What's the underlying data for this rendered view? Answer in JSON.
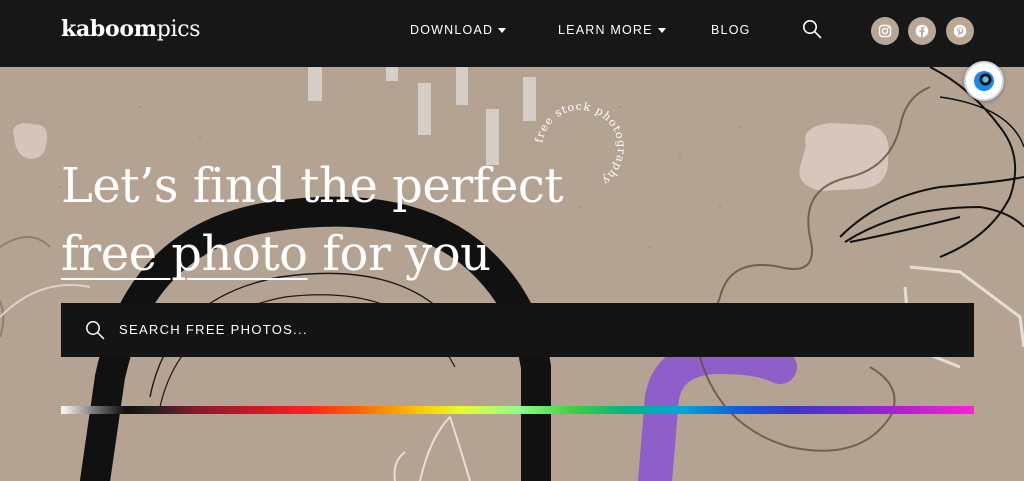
{
  "header": {
    "logo_bold": "kaboom",
    "logo_light": "pics",
    "nav": [
      {
        "label": "DOWNLOAD",
        "dropdown": true
      },
      {
        "label": "LEARN MORE",
        "dropdown": true
      },
      {
        "label": "BLOG",
        "dropdown": false
      }
    ],
    "search_icon": "search-icon",
    "social": [
      {
        "name": "instagram-icon"
      },
      {
        "name": "facebook-icon"
      },
      {
        "name": "pinterest-icon"
      }
    ]
  },
  "hero": {
    "headline_line1": "Let’s find the perfect",
    "headline_underlined": "free photo",
    "headline_rest": " for you",
    "circle_text": "free stock photography",
    "search_placeholder": "SEARCH FREE PHOTOS..."
  },
  "colors": {
    "header_bg": "#171717",
    "hero_bg": "#b4a393",
    "search_bg": "#141414",
    "social_bg": "#b8a696",
    "accent_purple": "#8e5ec9"
  }
}
